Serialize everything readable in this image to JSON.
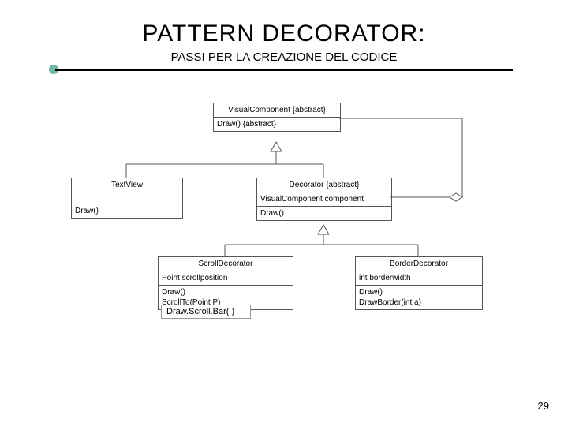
{
  "header": {
    "title": "PATTERN DECORATOR:",
    "subtitle": "PASSI PER LA CREAZIONE DEL CODICE"
  },
  "diagram": {
    "classes": [
      {
        "name": "VisualComponent {abstract}",
        "attrs": [],
        "ops": [
          "Draw() {abstract}"
        ]
      },
      {
        "name": "TextView",
        "attrs": [],
        "ops": [
          "Draw()"
        ]
      },
      {
        "name": "Decorator {abstract}",
        "attrs": [
          "VisualComponent component"
        ],
        "ops": [
          "Draw()"
        ]
      },
      {
        "name": "ScrollDecorator",
        "attrs": [
          "Point scrollposition"
        ],
        "ops": [
          "Draw()",
          "ScrollTo(Point P)"
        ]
      },
      {
        "name": "BorderDecorator",
        "attrs": [
          "int borderwidth"
        ],
        "ops": [
          "Draw()",
          "DrawBorder(int a)"
        ]
      }
    ],
    "extra_method": "Draw.Scroll.Bar( )",
    "relations": [
      {
        "type": "generalization",
        "from": "TextView",
        "to": "VisualComponent"
      },
      {
        "type": "generalization",
        "from": "Decorator",
        "to": "VisualComponent"
      },
      {
        "type": "aggregation",
        "from": "Decorator",
        "to": "VisualComponent",
        "role": "component"
      },
      {
        "type": "generalization",
        "from": "ScrollDecorator",
        "to": "Decorator"
      },
      {
        "type": "generalization",
        "from": "BorderDecorator",
        "to": "Decorator"
      }
    ]
  },
  "footer": {
    "page": "29"
  }
}
